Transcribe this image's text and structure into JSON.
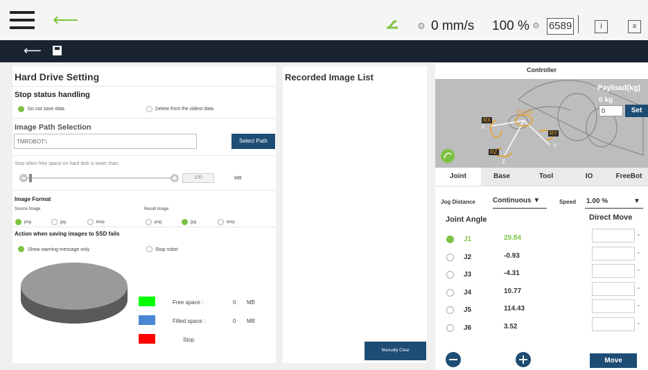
{
  "topbar": {
    "speed": "0 mm/s",
    "percent": "100 %",
    "counter": "6589",
    "info_label": "i",
    "log_label": "≡"
  },
  "hard_drive": {
    "title": "Hard Drive Setting",
    "stop_status": {
      "heading": "Stop status handling",
      "option_1": "Do not save data",
      "option_2": "Delete from the oldest data"
    },
    "image_path": {
      "heading": "Image Path Selection",
      "value": "TMROBOT:\\",
      "button": "Select Path"
    },
    "free_space": {
      "label": "Stop when free space on hard disk is lower than:",
      "value": "100",
      "unit": "MB",
      "slider_fraction": 0.0
    },
    "image_format": {
      "heading": "Image Format",
      "source_label": "Source Image",
      "result_label": "Result Image",
      "options": [
        "png",
        "jpg",
        "bmp"
      ],
      "source_selected": "png",
      "result_selected": "jpg"
    },
    "ssd_fail": {
      "heading": "Action when saving images to SSD fails",
      "option_1": "Show warning message only",
      "option_2": "Stop robot"
    },
    "legend": {
      "free_label": "Free space :",
      "free_value": "0",
      "free_unit": "MB",
      "filled_label": "Filled space :",
      "filled_value": "0",
      "filled_unit": "MB",
      "stop_label": "Stop",
      "free_color": "#00ff00",
      "filled_color": "#4a86d4",
      "stop_color": "#ff0000"
    }
  },
  "recorded": {
    "title": "Recorded Image List",
    "clear_button": "Manually Clear"
  },
  "controller": {
    "title": "Controller",
    "payload_label": "Payload(kg)",
    "payload_value": "0 kg",
    "payload_input": "0",
    "set_button": "Set",
    "axes": {
      "rx": "RX",
      "ry": "RY",
      "rz": "RZ",
      "x": "X",
      "y": "Y",
      "z": "Z",
      "origin": "(0,0,0)"
    },
    "tabs": [
      "Joint",
      "Base",
      "Tool",
      "IO",
      "FreeBot"
    ],
    "jog_distance_label": "Jog Distance",
    "jog_distance_value": "Continuous ▼",
    "speed_label": "Speed",
    "speed_value": "1.00 %",
    "joint_angle_label": "Joint Angle",
    "direct_move_label": "Direct Move",
    "joints": [
      {
        "name": "J1",
        "value": "29.84"
      },
      {
        "name": "J2",
        "value": "-0.93"
      },
      {
        "name": "J3",
        "value": "-4.31"
      },
      {
        "name": "J4",
        "value": "10.77"
      },
      {
        "name": "J5",
        "value": "114.43"
      },
      {
        "name": "J6",
        "value": "3.52"
      }
    ],
    "selected_joint": "J1",
    "degree": "°",
    "move_button": "Move"
  }
}
